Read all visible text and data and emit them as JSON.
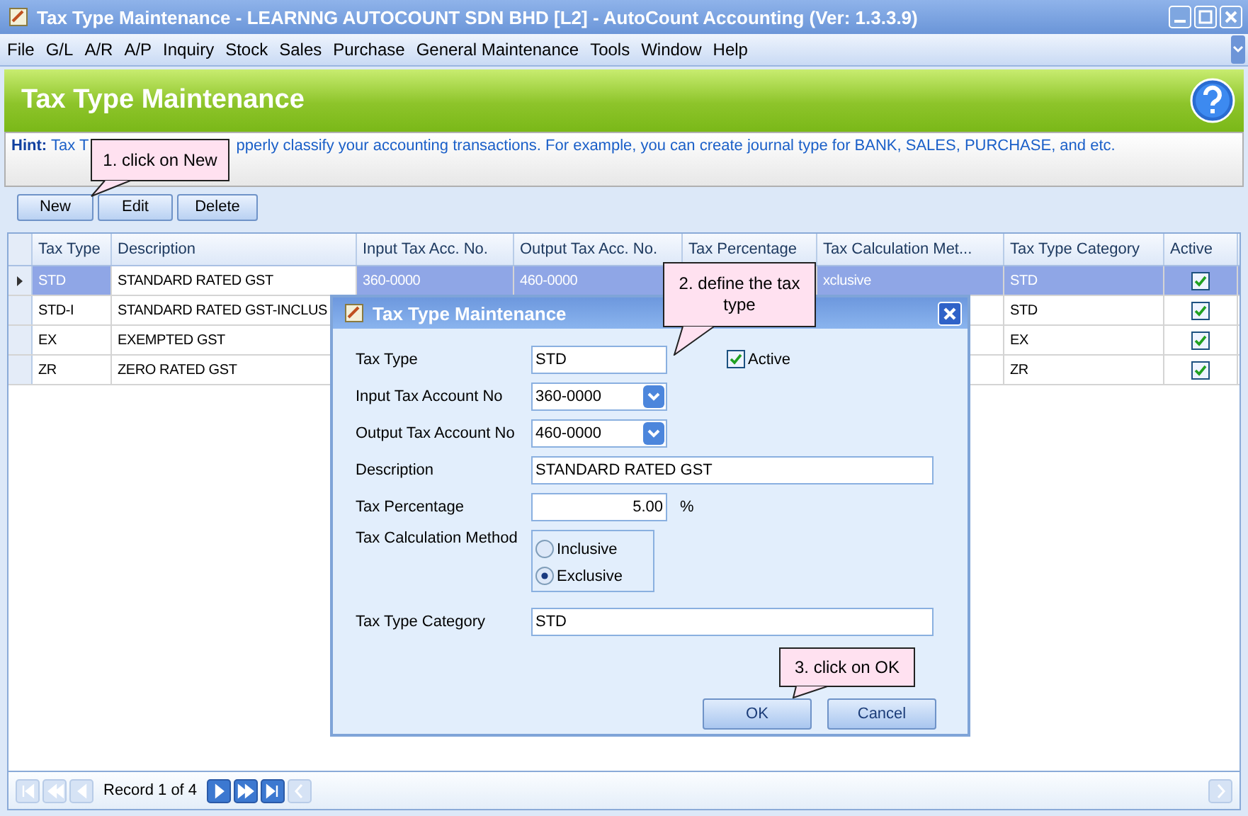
{
  "window": {
    "title": "Tax Type Maintenance - LEARNNG AUTOCOUNT SDN BHD [L2] - AutoCount Accounting (Ver: 1.3.3.9)"
  },
  "menu": [
    "File",
    "G/L",
    "A/R",
    "A/P",
    "Inquiry",
    "Stock",
    "Sales",
    "Purchase",
    "General Maintenance",
    "Tools",
    "Window",
    "Help"
  ],
  "header": {
    "title": "Tax Type Maintenance"
  },
  "hint": {
    "label": "Hint:",
    "parts": [
      "Tax T",
      "pperly classify your accounting transactions. For example, you can create journal type for BANK, SALES, PURCHASE, and etc."
    ]
  },
  "toolbar": [
    "New",
    "Edit",
    "Delete"
  ],
  "table": {
    "columns": [
      "Tax Type",
      "Description",
      "Input Tax Acc. No.",
      "Output Tax Acc. No.",
      "Tax Percentage",
      "Tax Calculation Met...",
      "Tax Type Category",
      "Active"
    ],
    "rows": [
      {
        "selected": true,
        "cells": [
          "STD",
          "STANDARD RATED GST",
          "360-0000",
          "460-0000",
          "",
          "xclusive",
          "STD"
        ],
        "active": true
      },
      {
        "selected": false,
        "cells": [
          "STD-I",
          "STANDARD RATED GST-INCLUS",
          "",
          "",
          "",
          "",
          "STD"
        ],
        "active": true
      },
      {
        "selected": false,
        "cells": [
          "EX",
          "EXEMPTED GST",
          "",
          "",
          "",
          "",
          "EX"
        ],
        "active": true
      },
      {
        "selected": false,
        "cells": [
          "ZR",
          "ZERO RATED GST",
          "",
          "",
          "",
          "",
          "ZR"
        ],
        "active": true
      }
    ]
  },
  "dialog": {
    "title": "Tax Type Maintenance",
    "active": {
      "label": "Active",
      "checked": true
    },
    "fields": [
      {
        "kind": "text",
        "label": "Tax Type",
        "value": "STD"
      },
      {
        "kind": "combo",
        "label": "Input Tax Account No",
        "value": "360-0000"
      },
      {
        "kind": "combo",
        "label": "Output Tax Account No",
        "value": "460-0000"
      },
      {
        "kind": "wide",
        "label": "Description",
        "value": "STANDARD RATED GST"
      },
      {
        "kind": "number",
        "label": "Tax Percentage",
        "value": "5.00",
        "unit": "%"
      },
      {
        "kind": "radio",
        "label": "Tax Calculation Method",
        "options": [
          {
            "label": "Inclusive",
            "selected": false
          },
          {
            "label": "Exclusive",
            "selected": true
          }
        ]
      },
      {
        "kind": "wide",
        "label": "Tax Type Category",
        "value": "STD"
      }
    ],
    "buttons": [
      "OK",
      "Cancel"
    ]
  },
  "callouts": [
    "1. click on New",
    "2. define the tax type",
    "3. click on OK"
  ],
  "navigator": {
    "record": "Record 1 of 4",
    "buttons": [
      {
        "kind": "first",
        "disabled": true
      },
      {
        "kind": "prev_page",
        "disabled": true
      },
      {
        "kind": "prev",
        "disabled": true
      },
      {
        "kind": "next",
        "disabled": false
      },
      {
        "kind": "next_page",
        "disabled": false
      },
      {
        "kind": "last",
        "disabled": false
      }
    ]
  }
}
